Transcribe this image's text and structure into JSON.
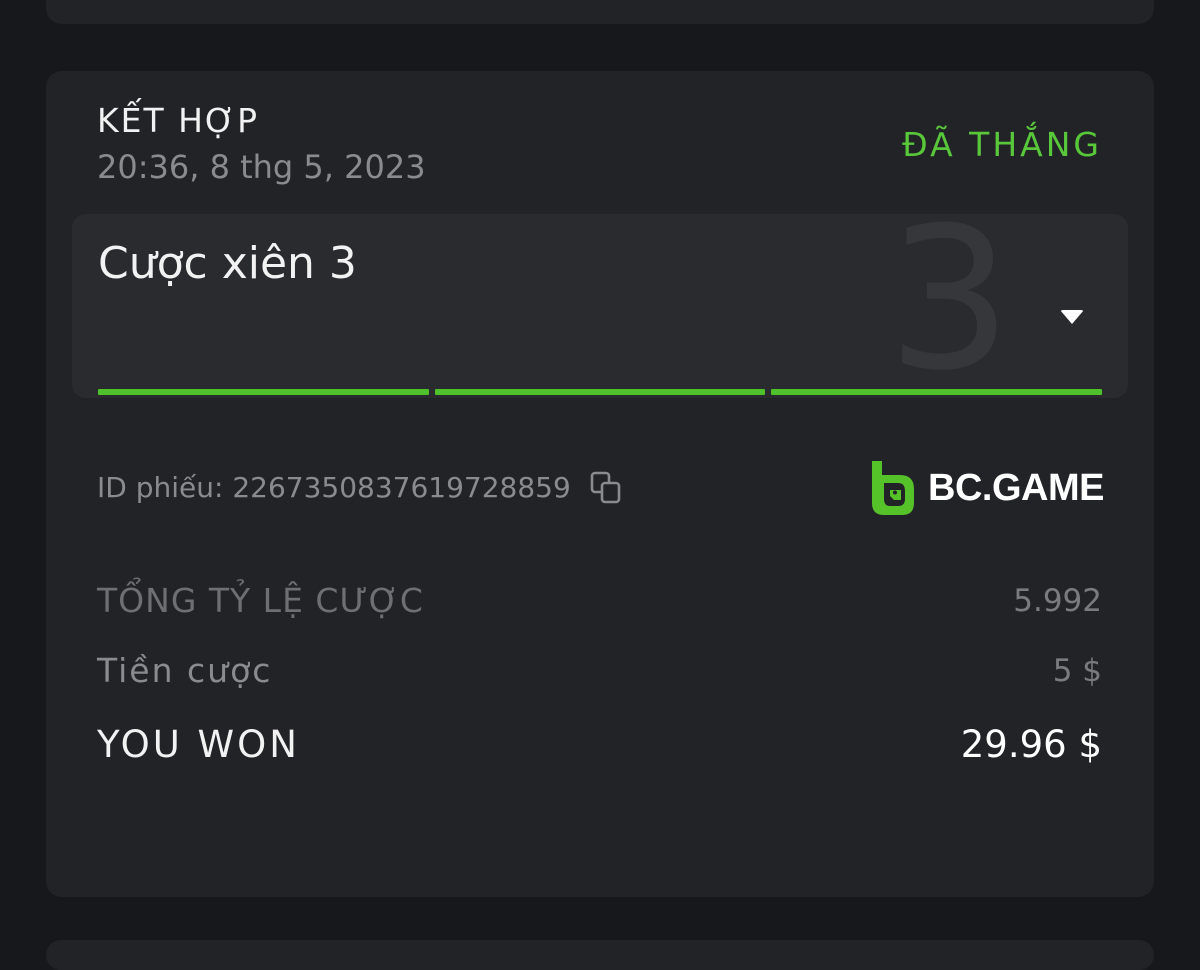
{
  "bet": {
    "type": "KẾT HỢP",
    "datetime": "20:36, 8 thg 5, 2023",
    "status": "ĐÃ THẮNG"
  },
  "parlay": {
    "title": "Cược xiên 3",
    "leg_count": "3",
    "legs_won": 3
  },
  "ticket": {
    "label": "ID phiếu: 2267350837619728859"
  },
  "brand": {
    "name": "BC.GAME"
  },
  "summary": {
    "total_odds_label": "TỔNG TỶ LỆ CƯỢC",
    "total_odds_value": "5.992",
    "stake_label": "Tiền cược",
    "stake_value": "5 $",
    "won_label": "YOU WON",
    "won_value": "29.96 $"
  },
  "colors": {
    "accent_green": "#4fc22b",
    "status_green": "#58c73a",
    "card_bg": "#222327",
    "page_bg": "#17181b"
  },
  "icons": [
    "caret-down-icon",
    "copy-icon",
    "bc-game-logo"
  ]
}
